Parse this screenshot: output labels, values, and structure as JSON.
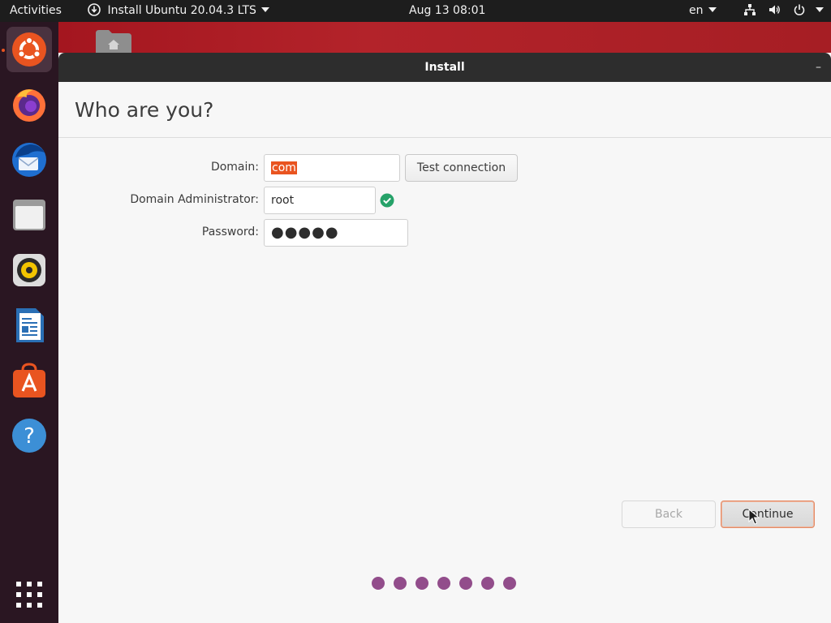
{
  "topbar": {
    "activities": "Activities",
    "app_menu": "Install Ubuntu 20.04.3 LTS",
    "clock": "Aug 13  08:01",
    "keyboard_layout": "en",
    "icons": [
      "network-icon",
      "volume-icon",
      "power-icon"
    ]
  },
  "dock": {
    "items": [
      "ubuntu-installer",
      "firefox",
      "thunderbird",
      "files",
      "rhythmbox",
      "libreoffice-writer",
      "ubuntu-software",
      "help"
    ],
    "show_apps": "show-applications"
  },
  "window": {
    "title": "Install",
    "minimize": "–",
    "heading": "Who are you?",
    "form": {
      "domain_label": "Domain:",
      "domain_value": "com",
      "test_connection": "Test connection",
      "admin_label": "Domain Administrator:",
      "admin_value": "root",
      "password_label": "Password:",
      "password_value": "●●●●●"
    },
    "buttons": {
      "back": "Back",
      "continue": "Continue"
    },
    "progress_steps": 7
  },
  "colors": {
    "accent": "#e95420",
    "progress": "#924d8b",
    "success": "#26a269"
  }
}
